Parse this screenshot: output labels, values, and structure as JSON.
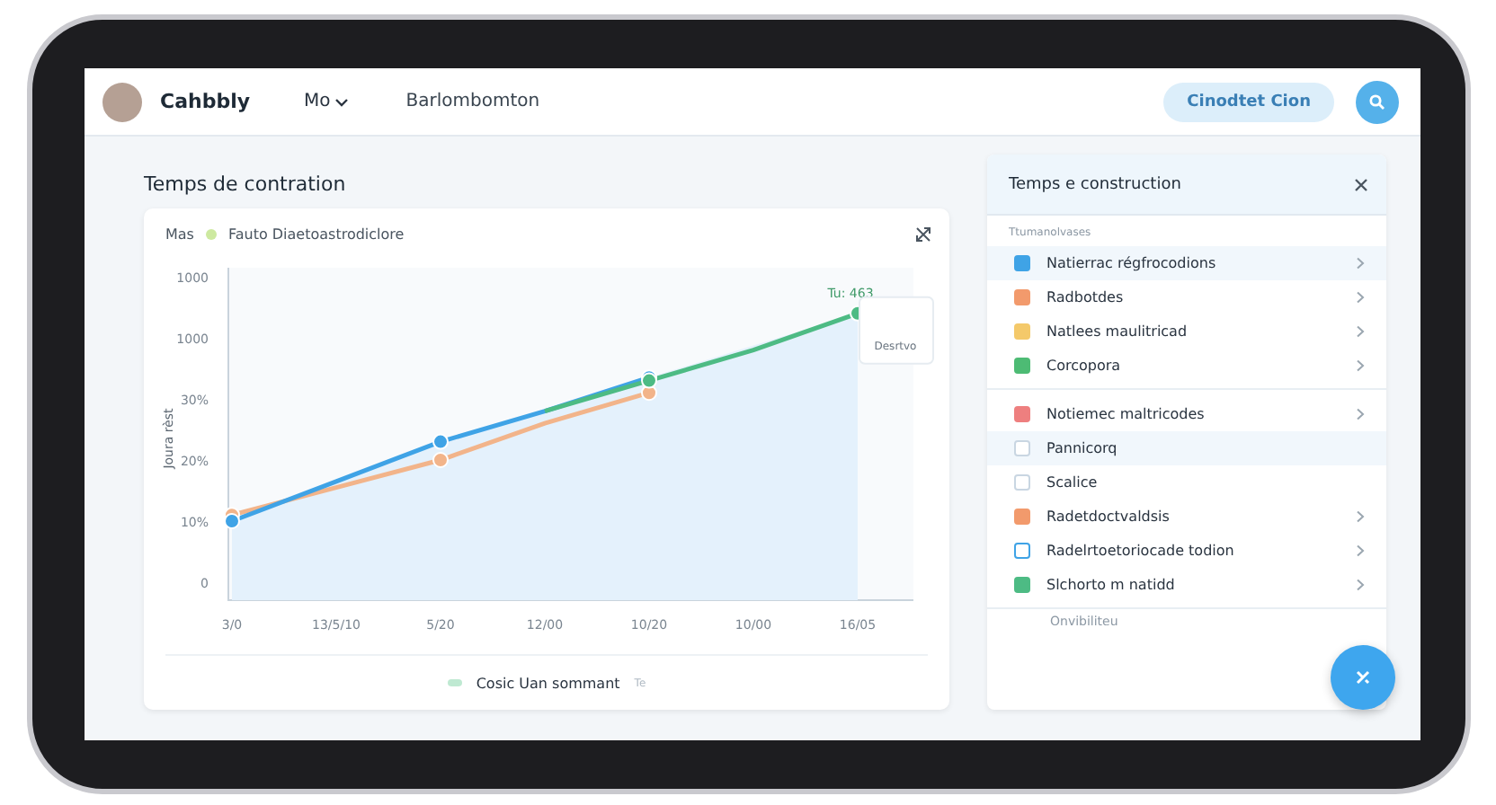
{
  "topbar": {
    "brand": "Cahbbly",
    "menu": "Mo",
    "link": "Barlombomton",
    "action": "Cinodtet Cion"
  },
  "main": {
    "title": "Temps de contration",
    "chart_card": {
      "tag": "Mas",
      "subtitle": "Fauto Diaetoastrodiclore",
      "chart": {
        "ylabel": "Joura rèst",
        "y_labels": [
          "1000",
          "1000",
          "30%",
          "20%",
          "10%",
          "0"
        ],
        "x_labels": [
          "3/0",
          "13/5/10",
          "5/20",
          "12/00",
          "10/20",
          "10/00",
          "16/05"
        ],
        "point_label": "Tu: 463",
        "tooltip": "Desrtvo"
      },
      "legend": {
        "label": "Cosic Uan sommant",
        "suffix": "Te"
      }
    }
  },
  "panel": {
    "title": "Temps e construction",
    "groups": [
      {
        "label": "Ttumanolvases",
        "items": [
          {
            "label": "Natierrac régfrocodions",
            "kind": "filled",
            "color": "#3fa3e6",
            "chevron": true,
            "selected": true
          },
          {
            "label": "Radbotdes",
            "kind": "filled",
            "color": "#f29a6c",
            "chevron": true,
            "selected": false
          },
          {
            "label": "Natlees maulitricad",
            "kind": "filled",
            "color": "#f4c96a",
            "chevron": true,
            "selected": false
          },
          {
            "label": "Corcopora",
            "kind": "filled",
            "color": "#4dbb74",
            "chevron": true,
            "selected": false
          }
        ]
      },
      {
        "items": [
          {
            "label": "Notiemec maltricodes",
            "kind": "filled",
            "color": "#ee7f7f",
            "chevron": true,
            "selected": false
          },
          {
            "label": "Pannicorq",
            "kind": "outline",
            "color": "#c9d6e2",
            "chevron": false,
            "selected": true
          },
          {
            "label": "Scalice",
            "kind": "outline",
            "color": "#c9d6e2",
            "chevron": false,
            "selected": false
          },
          {
            "label": "Radetdoctvaldsis",
            "kind": "filled",
            "color": "#f29a6c",
            "chevron": true,
            "selected": false
          },
          {
            "label": "Radelrtoetoriocade todion",
            "kind": "outline",
            "color": "#3fa3e6",
            "chevron": true,
            "selected": false
          },
          {
            "label": "Slchorto m natidd",
            "kind": "filled",
            "color": "#4dbb84",
            "chevron": true,
            "selected": false
          }
        ]
      }
    ],
    "cut_item": "Onvibiliteu"
  }
}
